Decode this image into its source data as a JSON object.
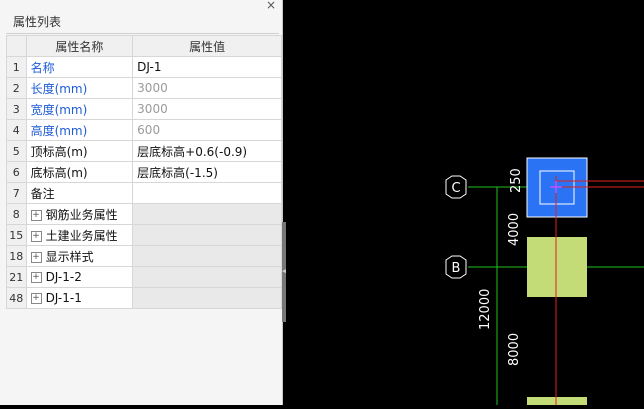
{
  "panel": {
    "title": "属性列表",
    "close_glyph": "×",
    "columns": {
      "name": "属性名称",
      "value": "属性值"
    },
    "rows": [
      {
        "num": "1",
        "name": "名称",
        "value": "DJ-1"
      },
      {
        "num": "2",
        "name": "长度(mm)",
        "value": "3000"
      },
      {
        "num": "3",
        "name": "宽度(mm)",
        "value": "3000"
      },
      {
        "num": "4",
        "name": "高度(mm)",
        "value": "600"
      },
      {
        "num": "5",
        "name": "顶标高(m)",
        "value": "层底标高+0.6(-0.9)"
      },
      {
        "num": "6",
        "name": "底标高(m)",
        "value": "层底标高(-1.5)"
      },
      {
        "num": "7",
        "name": "备注",
        "value": ""
      },
      {
        "num": "8",
        "name": "钢筋业务属性",
        "value": ""
      },
      {
        "num": "15",
        "name": "土建业务属性",
        "value": ""
      },
      {
        "num": "18",
        "name": "显示样式",
        "value": ""
      },
      {
        "num": "21",
        "name": "DJ-1-2",
        "value": ""
      },
      {
        "num": "48",
        "name": "DJ-1-1",
        "value": ""
      }
    ]
  },
  "cad": {
    "axis_labels": {
      "c": "C",
      "b": "B"
    },
    "dimensions": {
      "d250": "250",
      "d4000": "4000",
      "d12000": "12000",
      "d8000": "8000"
    }
  },
  "colors": {
    "grid_line": "#1ec21e",
    "axis_red": "#e02020",
    "selected_fill": "#2a73f5",
    "footing_fill": "#c4dc78",
    "label_blue": "#1e5bd6"
  }
}
